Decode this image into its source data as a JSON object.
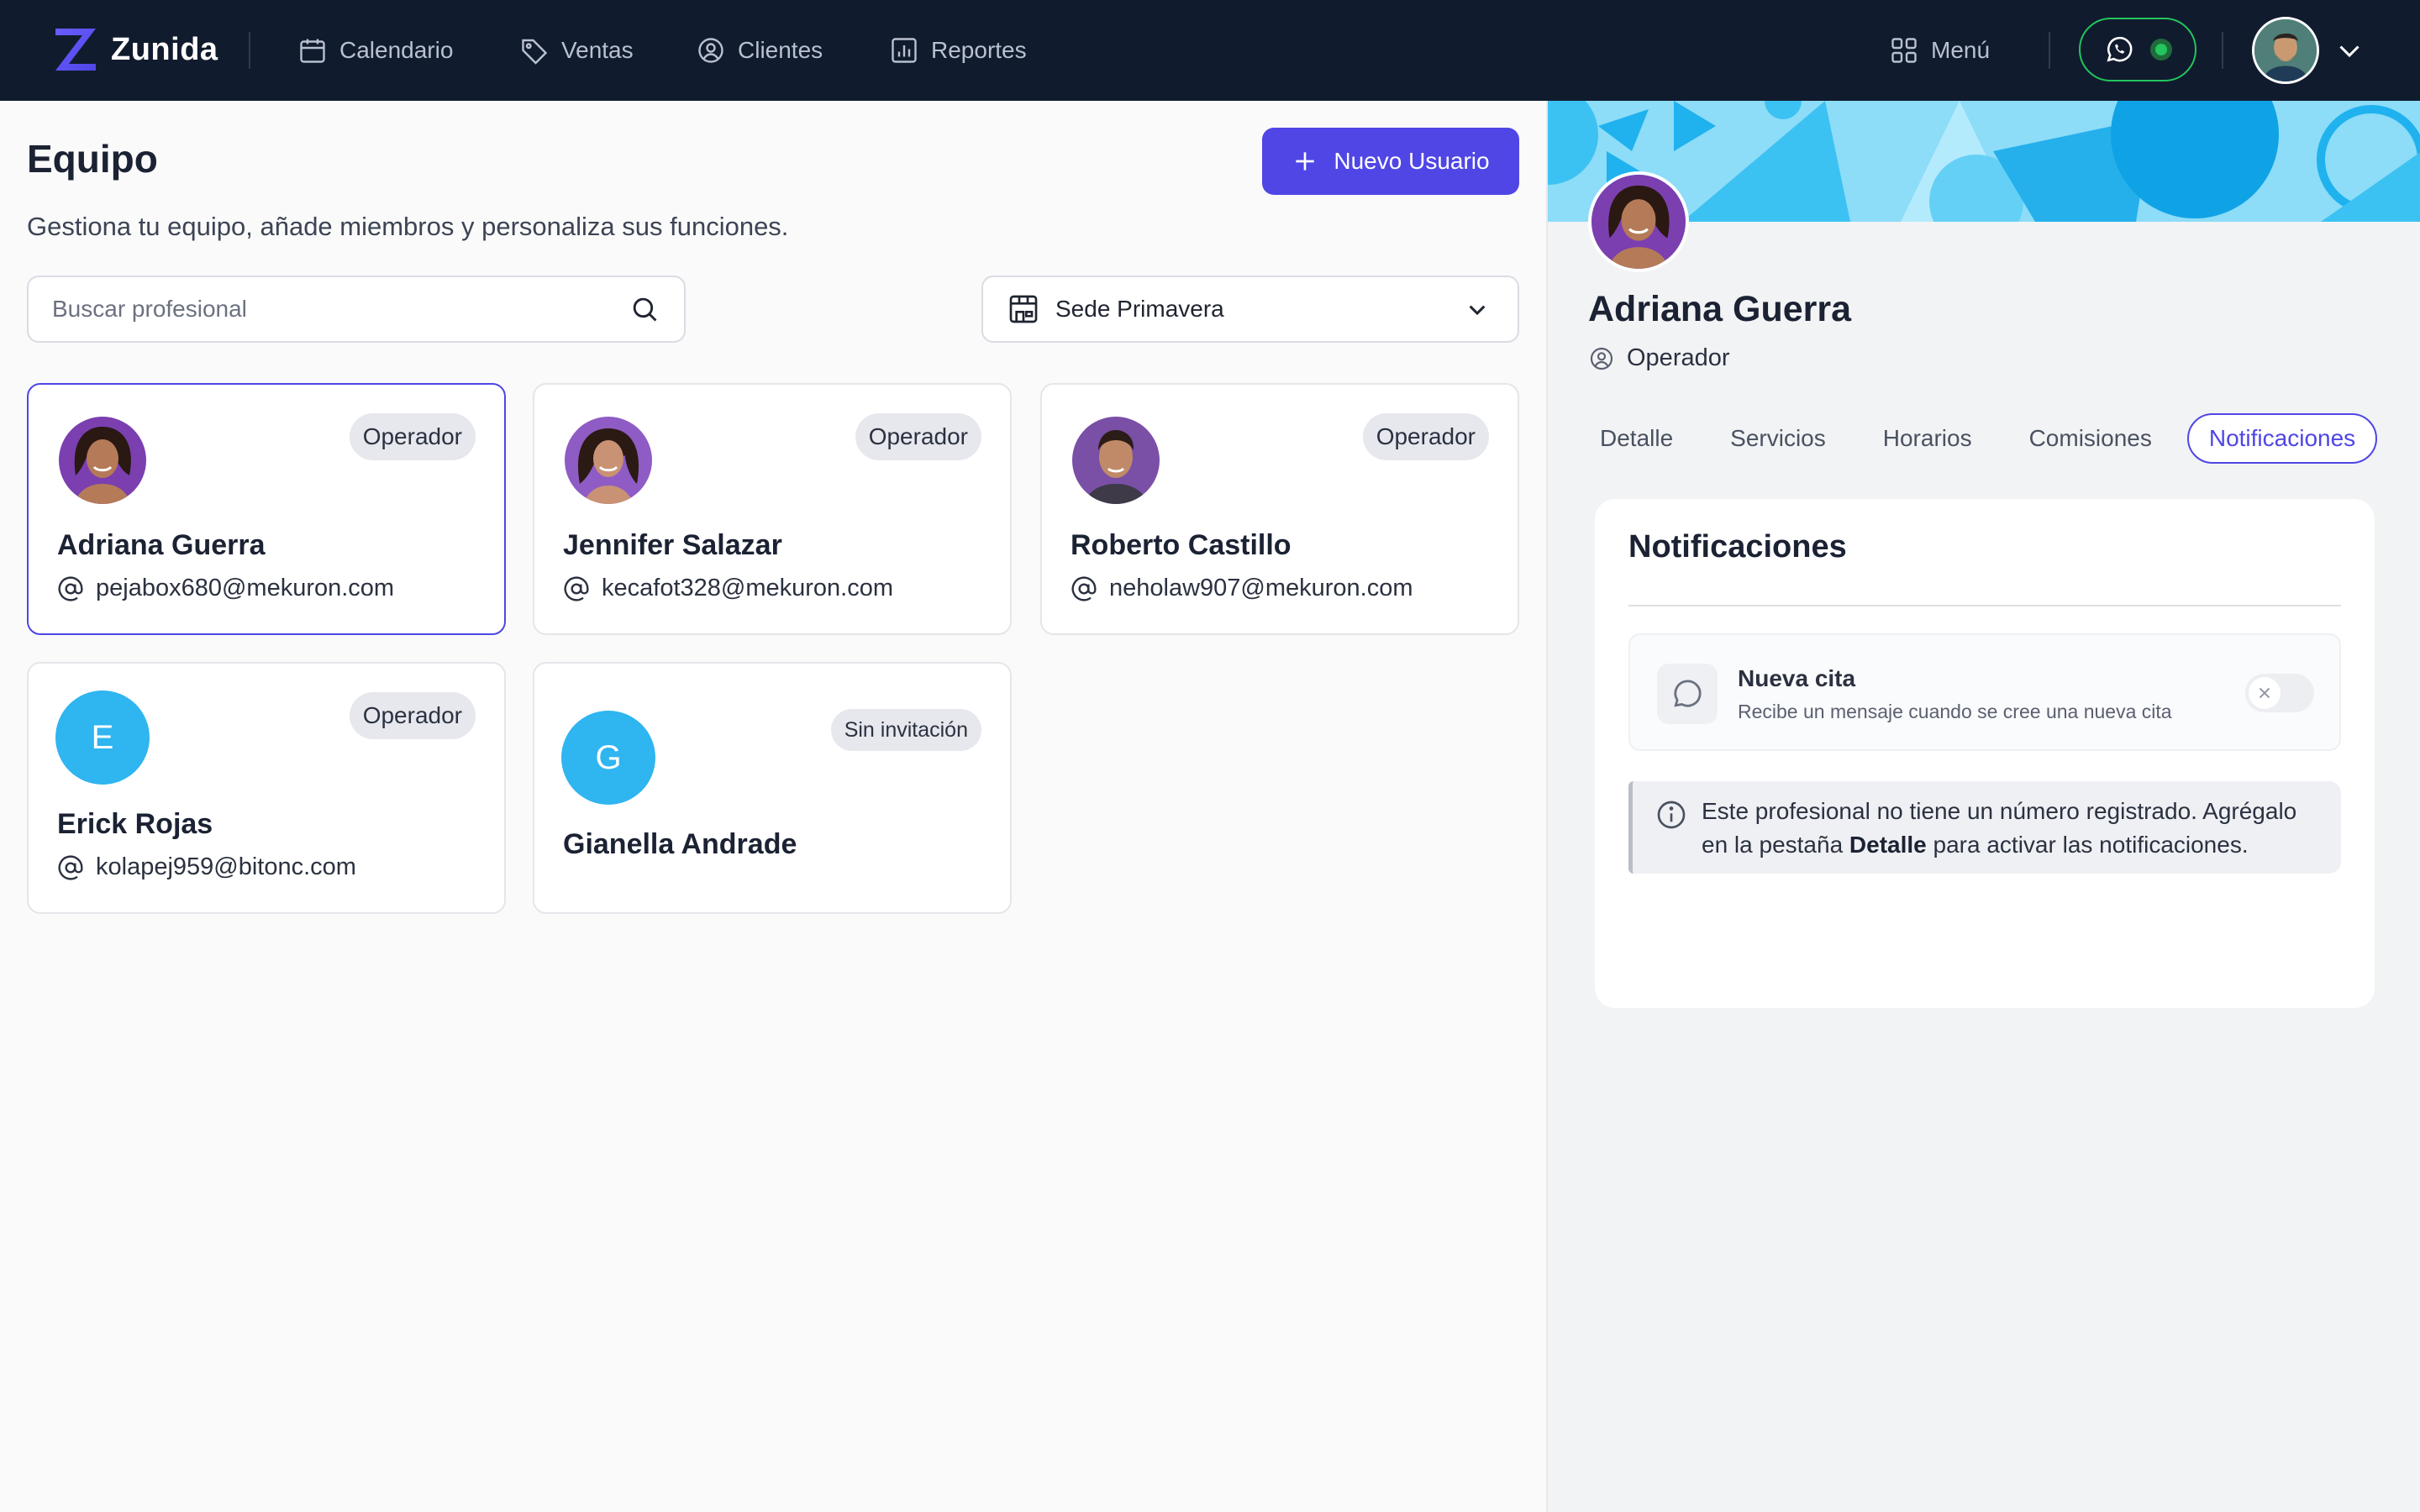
{
  "app": {
    "name": "Zunida"
  },
  "nav": {
    "items": [
      {
        "label": "Calendario",
        "icon": "calendar-icon"
      },
      {
        "label": "Ventas",
        "icon": "tag-icon"
      },
      {
        "label": "Clientes",
        "icon": "user-circle-icon"
      },
      {
        "label": "Reportes",
        "icon": "bar-chart-icon"
      }
    ],
    "menu_label": "Menú"
  },
  "page": {
    "title": "Equipo",
    "subtitle": "Gestiona tu equipo, añade miembros y personaliza sus funciones.",
    "new_user_button": "Nuevo Usuario",
    "search": {
      "placeholder": "Buscar profesional",
      "value": ""
    },
    "location_select": {
      "selected": "Sede Primavera"
    }
  },
  "members": [
    {
      "name": "Adriana Guerra",
      "email": "pejabox680@mekuron.com",
      "role": "Operador",
      "selected": true
    },
    {
      "name": "Jennifer Salazar",
      "email": "kecafot328@mekuron.com",
      "role": "Operador"
    },
    {
      "name": "Roberto Castillo",
      "email": "neholaw907@mekuron.com",
      "role": "Operador"
    },
    {
      "name": "Erick Rojas",
      "email": "kolapej959@bitonc.com",
      "role": "Operador",
      "initial": "E"
    },
    {
      "name": "Gianella Andrade",
      "email": "",
      "role": "Sin invitación",
      "initial": "G"
    }
  ],
  "panel": {
    "name": "Adriana Guerra",
    "role": "Operador",
    "tabs": [
      "Detalle",
      "Servicios",
      "Horarios",
      "Comisiones",
      "Notificaciones"
    ],
    "active_tab": "Notificaciones",
    "notifications": {
      "title": "Notificaciones",
      "item_title": "Nueva cita",
      "item_desc": "Recibe un mensaje cuando se cree una nueva cita",
      "item_enabled": false,
      "info_part1": "Este profesional no tiene un número registrado. Agrégalo en la pestaña ",
      "info_bold": "Detalle",
      "info_part2": " para activar las notificaciones."
    }
  },
  "colors": {
    "accent": "#4f46e5",
    "topbar": "#111b2e",
    "whatsapp": "#22c55e",
    "avatar_letter_bg": "#2fb5f0"
  }
}
